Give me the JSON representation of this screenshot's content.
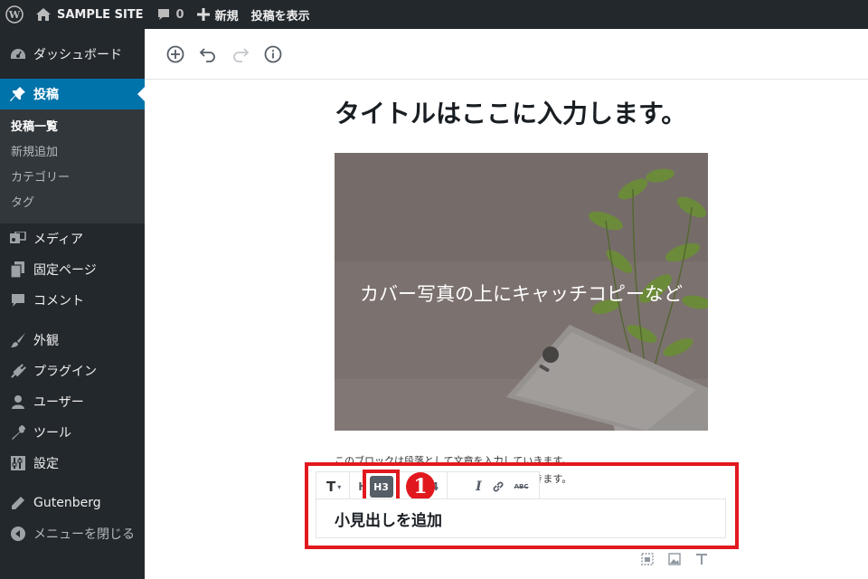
{
  "adminbar": {
    "site_name": "SAMPLE SITE",
    "comments_count": "0",
    "new_label": "新規",
    "view_post_label": "投稿を表示"
  },
  "sidebar": {
    "dashboard": "ダッシュボード",
    "posts": "投稿",
    "posts_sub": [
      "投稿一覧",
      "新規追加",
      "カテゴリー",
      "タグ"
    ],
    "media": "メディア",
    "pages": "固定ページ",
    "comments": "コメント",
    "appearance": "外観",
    "plugins": "プラグイン",
    "users": "ユーザー",
    "tools": "ツール",
    "settings": "設定",
    "gutenberg": "Gutenberg",
    "collapse": "メニューを閉じる"
  },
  "editor": {
    "post_title": "タイトルはここに入力します。",
    "cover_text": "カバー写真の上にキャッチコピーなど",
    "paragraph_line1": "このブロックは段落として文章を入力していきます。",
    "paragraph_line2": "このブロックは段落として文章を入力していきます。",
    "heading_text": "小見出しを追加",
    "toolbar": {
      "text_type": "T",
      "h2": "H2",
      "h3": "H3",
      "h4": "H4",
      "italic": "I",
      "strike": "ABC"
    },
    "badge_number": "1"
  },
  "colors": {
    "admin_dark": "#23282d",
    "active_blue": "#0073aa",
    "highlight_red": "#e2181f"
  }
}
